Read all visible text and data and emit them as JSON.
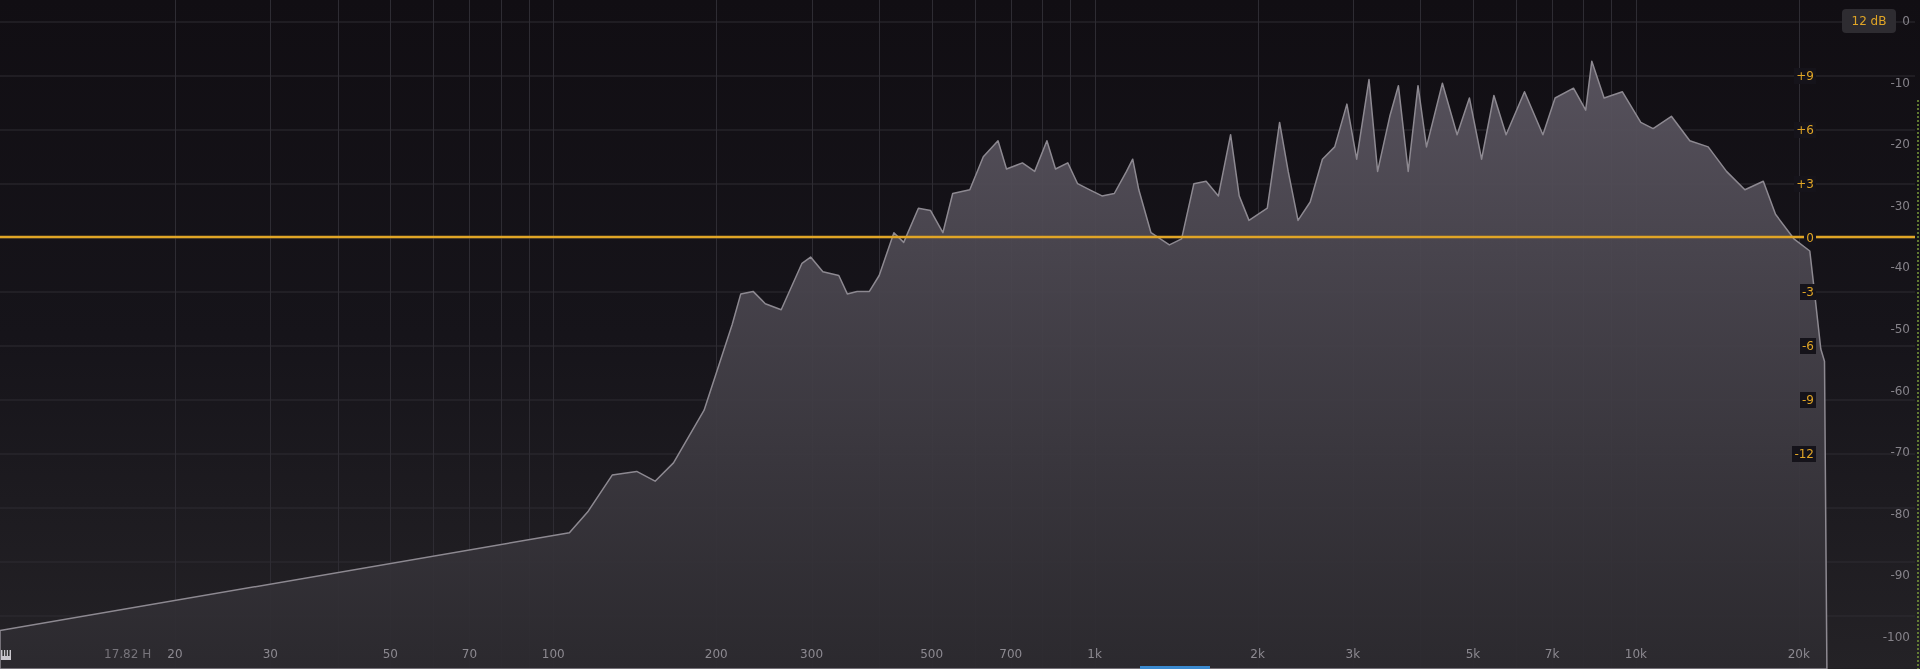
{
  "range_button": {
    "label": "12 dB"
  },
  "gain_labels": [
    "+9",
    "+6",
    "+3",
    "0",
    "-3",
    "-6",
    "-9",
    "-12"
  ],
  "db_labels": [
    "0",
    "-10",
    "-20",
    "-30",
    "-40",
    "-50",
    "-60",
    "-70",
    "-80",
    "-90",
    "-100"
  ],
  "freq_labels": [
    "20",
    "30",
    "50",
    "70",
    "100",
    "200",
    "300",
    "500",
    "700",
    "1k",
    "2k",
    "3k",
    "5k",
    "7k",
    "10k",
    "20k"
  ],
  "cursor_readout": "17.82 H"
}
